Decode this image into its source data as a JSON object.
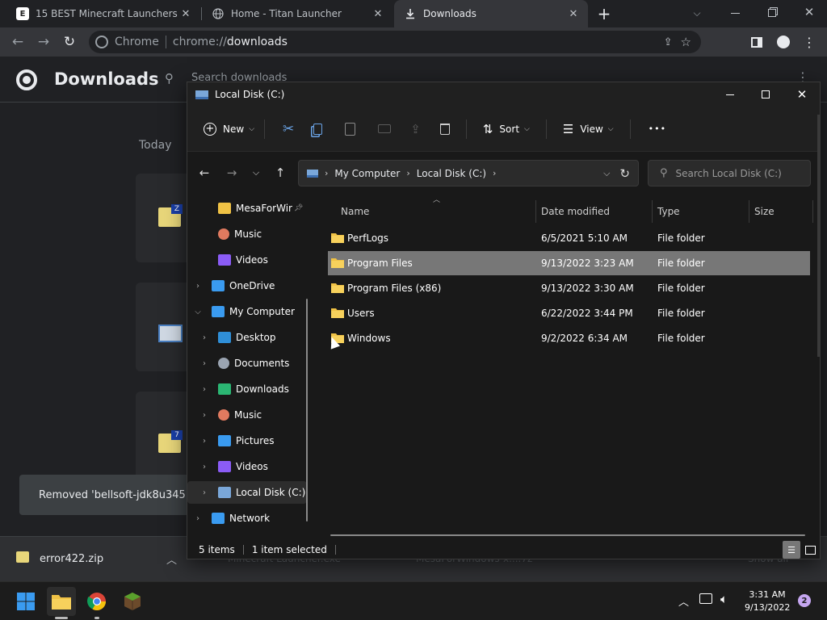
{
  "browser": {
    "tabs": [
      {
        "title": "15 BEST Minecraft Launchers In 2",
        "favicon": "E",
        "active": false
      },
      {
        "title": "Home - Titan Launcher",
        "favicon": "globe-icon",
        "active": false
      },
      {
        "title": "Downloads",
        "favicon": "download-icon",
        "active": true
      }
    ],
    "new_tab": "+",
    "omnibox": {
      "scheme_label": "Chrome",
      "url_prefix": "chrome://",
      "url_host": "downloads"
    }
  },
  "downloads_page": {
    "title": "Downloads",
    "search_placeholder": "Search downloads",
    "date_group": "Today",
    "toast": "Removed 'bellsoft-jdk8u345+1-w",
    "shelf_item": "error422.zip",
    "hidden_shelf_items": [
      "Minecraft Launcher.exe",
      "MesaForWindows-x....7z",
      "Show all"
    ]
  },
  "explorer": {
    "title": "Local Disk (C:)",
    "commands": {
      "new": "New",
      "sort": "Sort",
      "view": "View",
      "more": "•••"
    },
    "breadcrumb": [
      "My Computer",
      "Local Disk (C:)"
    ],
    "search_placeholder": "Search Local Disk (C:)",
    "nav": [
      {
        "label": "MesaForWir",
        "icon": "folder-icon",
        "pinned": true,
        "indent": 1,
        "chevron": false
      },
      {
        "label": "Music",
        "icon": "music-icon",
        "indent": 1,
        "chevron": false
      },
      {
        "label": "Videos",
        "icon": "video-icon",
        "indent": 1,
        "chevron": false
      },
      {
        "label": "OneDrive",
        "icon": "cloud-icon",
        "indent": 0,
        "chevron": "right"
      },
      {
        "label": "My Computer",
        "icon": "computer-icon",
        "indent": 0,
        "chevron": "down"
      },
      {
        "label": "Desktop",
        "icon": "desktop-icon",
        "indent": 1,
        "chevron": "right"
      },
      {
        "label": "Documents",
        "icon": "documents-icon",
        "indent": 1,
        "chevron": "right"
      },
      {
        "label": "Downloads",
        "icon": "downloads-icon",
        "indent": 1,
        "chevron": "right"
      },
      {
        "label": "Music",
        "icon": "music-icon",
        "indent": 1,
        "chevron": "right"
      },
      {
        "label": "Pictures",
        "icon": "pictures-icon",
        "indent": 1,
        "chevron": "right"
      },
      {
        "label": "Videos",
        "icon": "video-icon",
        "indent": 1,
        "chevron": "right"
      },
      {
        "label": "Local Disk (C:)",
        "icon": "drive-icon",
        "indent": 1,
        "chevron": "right",
        "selected": true
      },
      {
        "label": "Network",
        "icon": "network-icon",
        "indent": 0,
        "chevron": "right"
      }
    ],
    "columns": {
      "name": "Name",
      "date": "Date modified",
      "type": "Type",
      "size": "Size"
    },
    "files": [
      {
        "name": "PerfLogs",
        "date": "6/5/2021 5:10 AM",
        "type": "File folder",
        "selected": false
      },
      {
        "name": "Program Files",
        "date": "9/13/2022 3:23 AM",
        "type": "File folder",
        "selected": true
      },
      {
        "name": "Program Files (x86)",
        "date": "9/13/2022 3:30 AM",
        "type": "File folder",
        "selected": false
      },
      {
        "name": "Users",
        "date": "6/22/2022 3:44 PM",
        "type": "File folder",
        "selected": false
      },
      {
        "name": "Windows",
        "date": "9/2/2022 6:34 AM",
        "type": "File folder",
        "selected": false
      }
    ],
    "status": {
      "count": "5 items",
      "selection": "1 item selected"
    }
  },
  "taskbar": {
    "time": "3:31 AM",
    "date": "9/13/2022",
    "notifications": "2"
  },
  "colors": {
    "folder": "#f0c245",
    "selected_row": "#777777",
    "chrome_bg": "#202124"
  }
}
